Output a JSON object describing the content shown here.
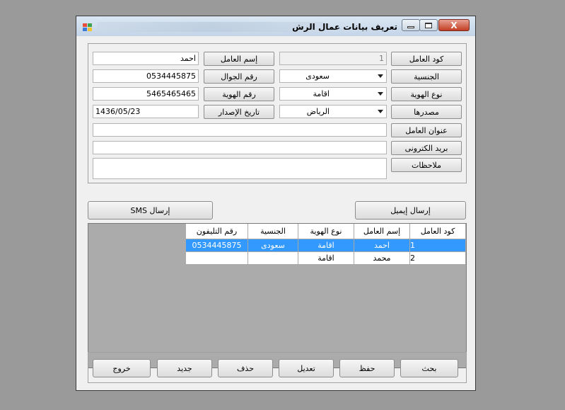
{
  "window": {
    "title": "تعريف بيانات عمال الرش",
    "close_label": "X"
  },
  "form": {
    "right_labels": [
      "كود العامل",
      "الجنسية",
      "نوع الهوية",
      "مصدرها",
      "عنوان العامل",
      "بريد الكترونى",
      "ملاحظات"
    ],
    "worker_code": "1",
    "nationality": "سعودى",
    "id_type": "اقامة",
    "id_source": "الرياض",
    "mid_labels": [
      "إسم العامل",
      "رقم الجوال",
      "رقم الهوية",
      "تاريخ الإصدار"
    ],
    "worker_name": "احمد",
    "mobile": "0534445875",
    "id_number": "5465465465",
    "issue_date": "1436/05/23",
    "address": "",
    "email": "",
    "notes": ""
  },
  "actions": {
    "send_email": "إرسال إيميل",
    "send_sms": "إرسال SMS"
  },
  "grid": {
    "columns": [
      "كود العامل",
      "إسم العامل",
      "نوع الهوية",
      "الجنسية",
      "رقم التليفون"
    ],
    "rows": [
      [
        "1",
        "احمد",
        "اقامة",
        "سعودى",
        "0534445875"
      ],
      [
        "2",
        "محمد",
        "اقامة",
        "",
        ""
      ]
    ],
    "selected_row": 0
  },
  "buttons": {
    "search": "بحث",
    "save": "حفظ",
    "edit": "تعديل",
    "delete": "حذف",
    "new": "جديد",
    "exit": "خروج"
  },
  "colors": {
    "selection": "#3399ff",
    "close_button": "#c23d23"
  }
}
